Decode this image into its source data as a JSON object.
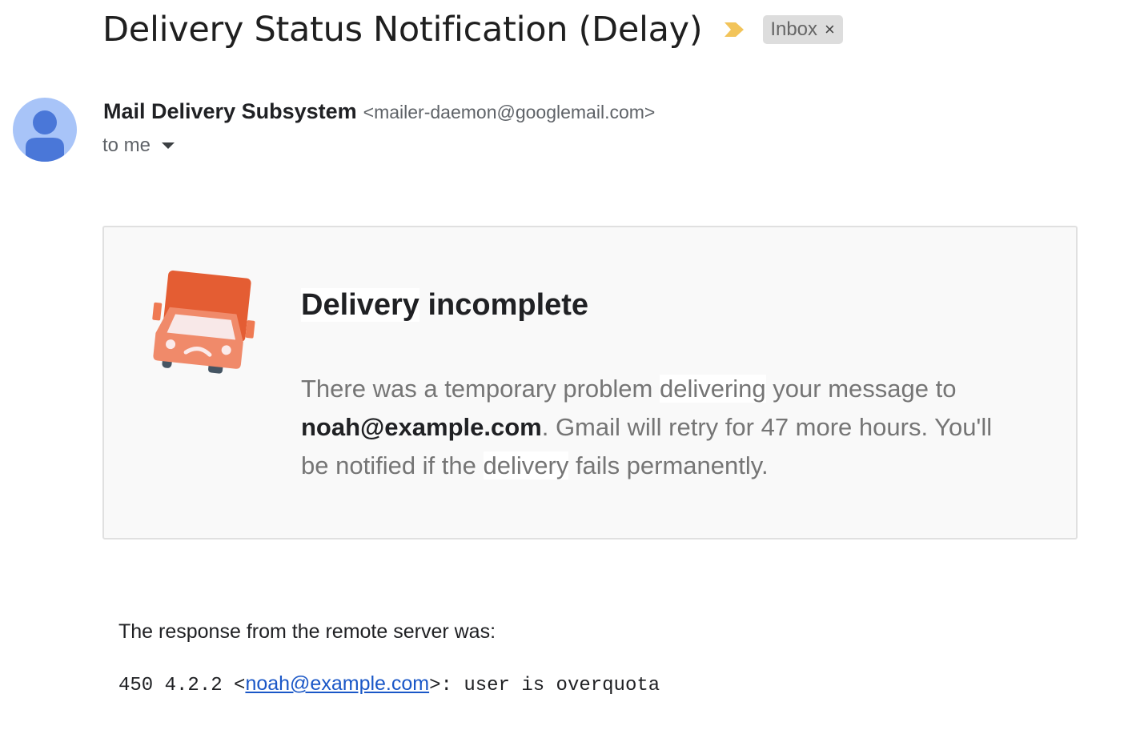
{
  "header": {
    "subject": "Delivery Status Notification (Delay)",
    "importance_icon": "importance-marker-icon",
    "importance_color": "#f2c45a",
    "label_chip": {
      "label": "Inbox",
      "remove_glyph": "×"
    }
  },
  "sender": {
    "name": "Mail Delivery Subsystem",
    "email": "<mailer-daemon@googlemail.com>",
    "recipient_label": "to me",
    "avatar_icon": "default-person-avatar-icon",
    "avatar_bg": "#a8c4f8",
    "avatar_fg": "#4a77d8"
  },
  "notice": {
    "icon": "sad-truck-icon",
    "title_highlight": "Delivery",
    "title_rest": " incomplete",
    "body_part1": "There was a temporary problem ",
    "body_hl1": "delivering",
    "body_part2": " your message to ",
    "recipient": "noah@example.com",
    "body_part3": ". Gmail will retry for 47 more hours. You'll be notified if the ",
    "body_hl2": "delivery",
    "body_part4": " fails permanently."
  },
  "response": {
    "label": "The response from the remote server was:",
    "code_prefix": "450 4.2.2 <",
    "address": "noah@example.com",
    "code_suffix": ">: user is overquota"
  }
}
